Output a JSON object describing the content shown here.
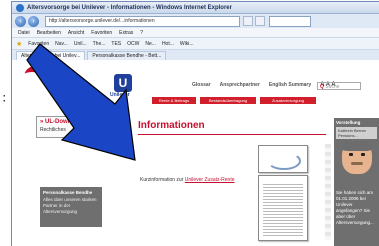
{
  "browser": {
    "title": "Altersvorsorge bei Unilever - Informationen - Windows Internet Explorer",
    "address": "http://altersvorsorge.unilever.de/...informationen",
    "menu": [
      "Datei",
      "Bearbeiten",
      "Ansicht",
      "Favoriten",
      "Extras",
      "?"
    ],
    "favorites_label": "Favoriten",
    "favorites": [
      "Nav...",
      "Unil...",
      "The...",
      "TES",
      "OCW",
      "Ne...",
      "Hot...",
      "Wiki..."
    ],
    "tabs": [
      "Altersvorsorge bei Unilev...",
      "Personalkasse Bendhe - Bett..."
    ]
  },
  "site": {
    "logo_text": "Unilever",
    "logo_letter": "U",
    "topnav": [
      "Glossar",
      "Ansprechpartner",
      "English Summary"
    ],
    "font_size_label": "A A A",
    "search_placeholder": "Suche",
    "rednav": [
      "Rente & Beitrags",
      "Bestandsübertragung",
      "Zusatzversorgung"
    ]
  },
  "sidebar": {
    "active_item": "UL-Downloads",
    "sub_item": "Rechtliches",
    "promo_title": "Personalkasse Bendhe",
    "promo_text": "Alles über unseren starken Partner in der Altersversorgung"
  },
  "main": {
    "heading": "Informationen",
    "kurzinfo_prefix": "Kurzinformation zur ",
    "kurzinfo_link": "Unilever Zusatz-Rente"
  },
  "rightpanel": {
    "title": "Vorstellung",
    "subtitle": "Kathrein Berner Pensions...",
    "text": "Sie haben sich am 01.01.2006 bei Unilever angefangen? Sie aber über Altersversorgung..."
  },
  "colors": {
    "accent_red": "#c8102e",
    "unilever_blue": "#1f3f9a",
    "arrow_blue": "#1a45c4"
  }
}
